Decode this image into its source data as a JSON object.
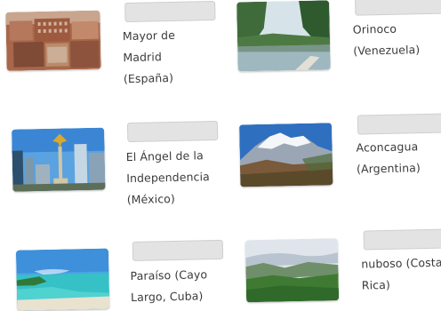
{
  "items": [
    {
      "caption_lines": [
        "Mayor de",
        "Madrid",
        "(España)"
      ],
      "image": "madrid-plaza-mayor-photo"
    },
    {
      "caption_lines": [
        "Orinoco",
        "(Venezuela)"
      ],
      "image": "orinoco-river-photo"
    },
    {
      "caption_lines": [
        "El Ángel de la",
        "Independencia",
        "(México)"
      ],
      "image": "angel-independencia-photo"
    },
    {
      "caption_lines": [
        "Aconcagua",
        "(Argentina)"
      ],
      "image": "aconcagua-mountain-photo"
    },
    {
      "caption_lines": [
        "Paraíso (Cayo",
        "Largo, Cuba)"
      ],
      "image": "cayo-largo-beach-photo"
    },
    {
      "caption_lines": [
        "nuboso (Costa",
        "Rica)"
      ],
      "image": "cloud-forest-photo"
    }
  ],
  "answer_boxes": [
    "",
    "",
    "",
    "",
    "",
    ""
  ]
}
